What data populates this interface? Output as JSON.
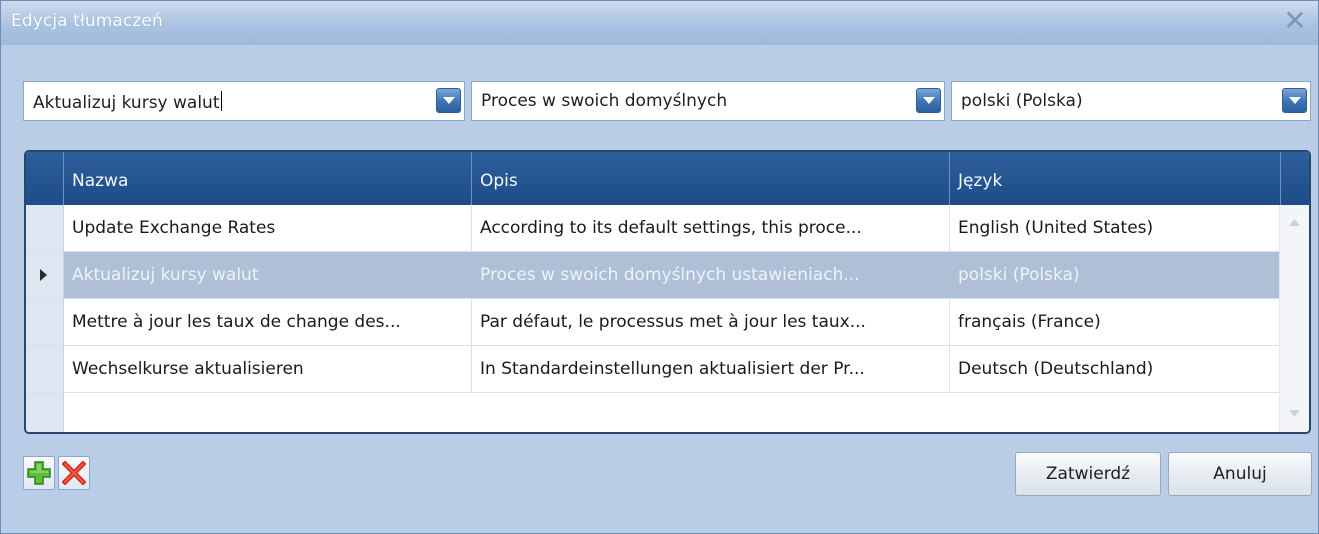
{
  "window": {
    "title": "Edycja tłumaczeń",
    "close_icon": "close-icon"
  },
  "filters": {
    "name": {
      "value": "Aktualizuj kursy walut"
    },
    "description": {
      "value": "Proces w swoich domyślnych"
    },
    "language": {
      "value": "polski (Polska)"
    }
  },
  "grid": {
    "columns": [
      "Nazwa",
      "Opis",
      "Język"
    ],
    "rows": [
      {
        "name": "Update Exchange Rates",
        "description": "According to its default settings, this proce...",
        "language": "English (United States)",
        "selected": false
      },
      {
        "name": "Aktualizuj kursy walut",
        "description": "Proces w swoich domyślnych ustawieniach...",
        "language": "polski (Polska)",
        "selected": true
      },
      {
        "name": "Mettre à jour les taux de change des...",
        "description": "Par défaut, le processus met à jour les taux...",
        "language": "français (France)",
        "selected": false
      },
      {
        "name": "Wechselkurse aktualisieren",
        "description": "In Standardeinstellungen aktualisiert der Pr...",
        "language": "Deutsch (Deutschland)",
        "selected": false
      }
    ]
  },
  "toolbar": {
    "add_icon": "plus-icon",
    "delete_icon": "delete-x-icon"
  },
  "actions": {
    "confirm_label": "Zatwierdź",
    "cancel_label": "Anuluj"
  },
  "colors": {
    "header": "#2d5f9c",
    "selected_row": "#aebfd6",
    "window_bg": "#b9cde6"
  }
}
